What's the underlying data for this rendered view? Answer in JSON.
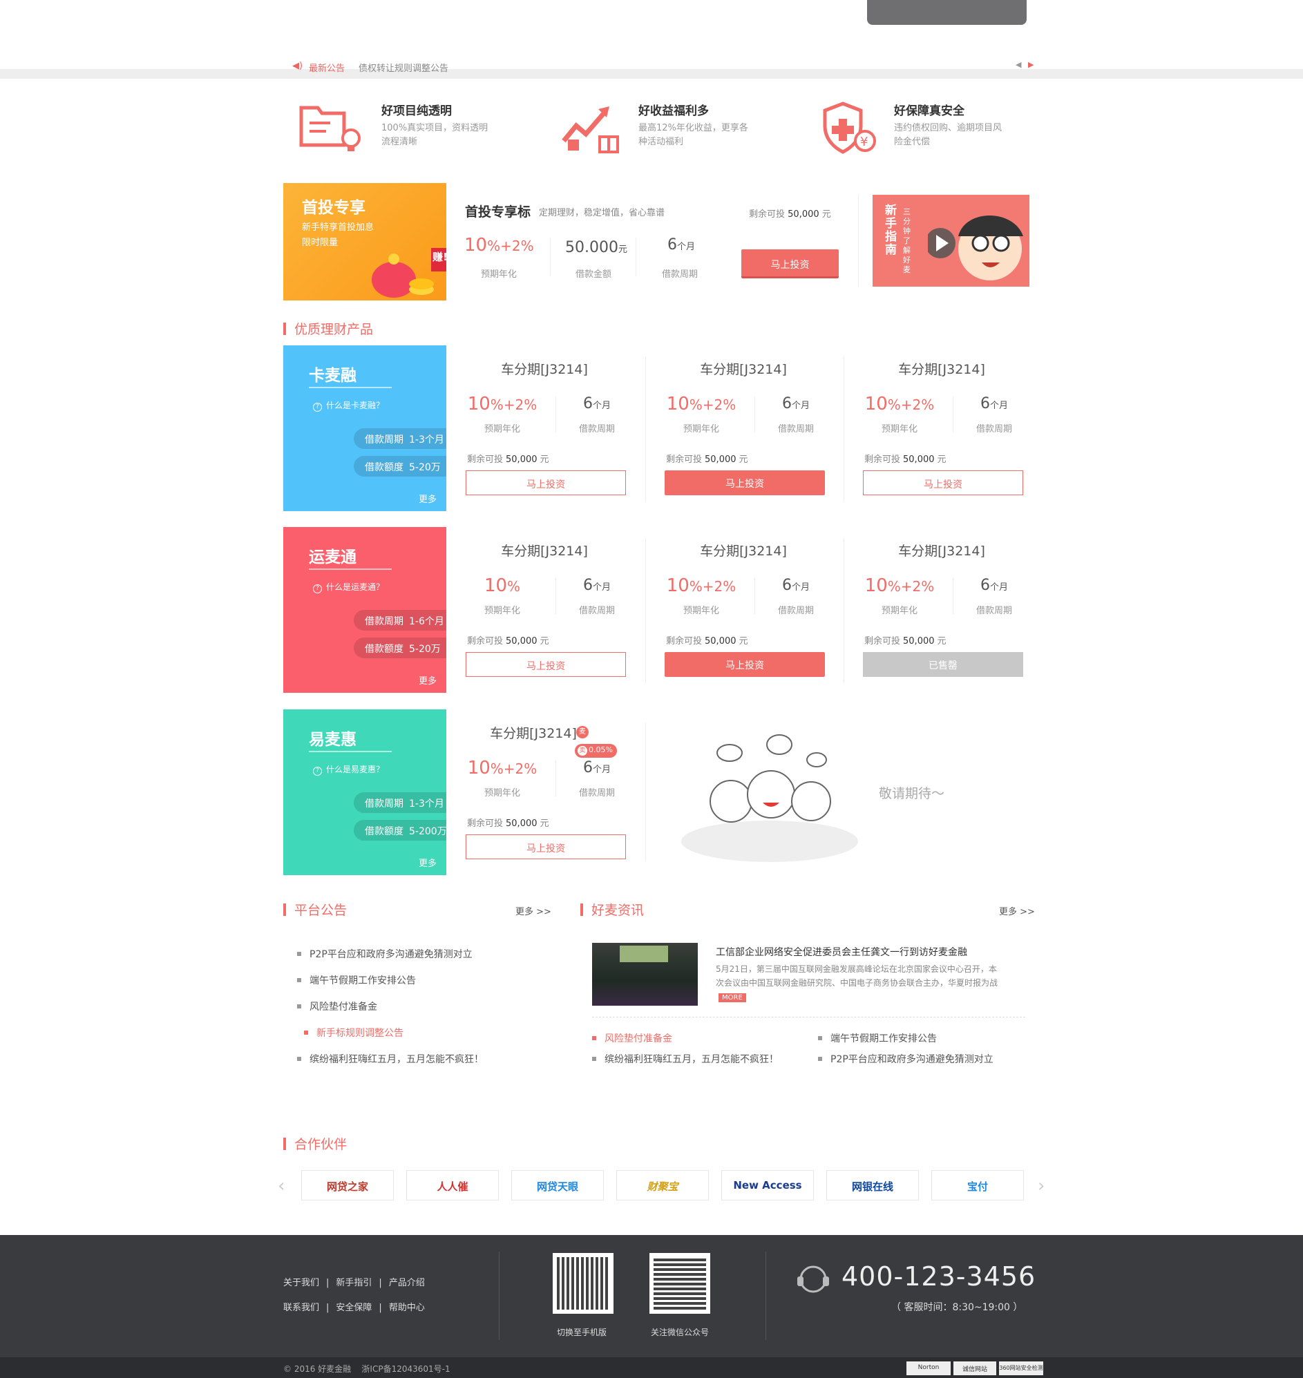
{
  "notice": {
    "icon": "speaker-icon",
    "title": "最新公告",
    "text": "债权转让规则调整公告"
  },
  "features": [
    {
      "icon": "folder-bulb-icon",
      "title": "好项目纯透明",
      "l1": "100%真实项目，资料透明",
      "l2": "流程清晰"
    },
    {
      "icon": "chart-gift-icon",
      "title": "好收益福利多",
      "l1": "最高12%年化收益，更享各",
      "l2": "种活动福利"
    },
    {
      "icon": "shield-yuan-icon",
      "title": "好保障真安全",
      "l1": "违约债权回购、逾期项目风",
      "l2": "险金代偿"
    }
  ],
  "first": {
    "banner_title": "首投专享",
    "banner_sub1": "新手特享首投加息",
    "banner_sub2": "限时限量",
    "banner_badge": "赚!",
    "name": "首投专享标",
    "tagline": "定期理财，稳定增值，省心靠谱",
    "remain_label": "剩余可投",
    "remain_value": "50,000",
    "remain_unit": "元",
    "rate": "10",
    "rate_plus": "%+2%",
    "rate_label": "预期年化",
    "amount": "50.000",
    "amount_unit": "元",
    "amount_label": "借款金额",
    "period": "6",
    "period_unit": "个月",
    "period_label": "借款周期",
    "button": "马上投资"
  },
  "guide": {
    "title": "新手指南",
    "sub": "三分钟了解好麦"
  },
  "products_section": "优质理财产品",
  "categories": [
    {
      "name": "卡麦融",
      "q": "什么是卡麦融？",
      "p1_label": "借款周期",
      "p1": "1-3个月",
      "p2_label": "借款额度",
      "p2": "5-20万",
      "more": "更多",
      "color": "#52c2fb"
    },
    {
      "name": "运麦通",
      "q": "什么是运麦通？",
      "p1_label": "借款周期",
      "p1": "1-6个月",
      "p2_label": "借款额度",
      "p2": "5-20万",
      "more": "更多",
      "color": "#fb5f6c"
    },
    {
      "name": "易麦惠",
      "q": "什么是易麦惠？",
      "p1_label": "借款周期",
      "p1": "1-3个月",
      "p2_label": "借款额度",
      "p2": "5-200万",
      "more": "更多",
      "color": "#3fd8b8"
    }
  ],
  "product_common": {
    "title": "车分期[J3214]",
    "rate_label": "预期年化",
    "period": "6",
    "period_unit": "个月",
    "period_label": "借款周期",
    "remain_label": "剩余可投",
    "remain_value": "50,000",
    "remain_unit": "元"
  },
  "rows": [
    [
      {
        "rate": "10",
        "plus": "%+2%",
        "btn": "马上投资",
        "style": "out"
      },
      {
        "rate": "10",
        "plus": "%+2%",
        "btn": "马上投资",
        "style": "red"
      },
      {
        "rate": "10",
        "plus": "%+2%",
        "btn": "马上投资",
        "style": "out"
      }
    ],
    [
      {
        "rate": "10",
        "plus": "%",
        "btn": "马上投资",
        "style": "out"
      },
      {
        "rate": "10",
        "plus": "%+2%",
        "btn": "马上投资",
        "style": "red"
      },
      {
        "rate": "10",
        "plus": "%+2%",
        "btn": "已售罄",
        "style": "gray"
      }
    ],
    [
      {
        "rate": "10",
        "plus": "%+2%",
        "btn": "马上投资",
        "style": "out",
        "badge1": "麦",
        "badge2": "0.05%",
        "badge2_icon": "卖"
      }
    ]
  ],
  "coming": "敬请期待～",
  "announce": {
    "title": "平台公告",
    "more": "更多 >>",
    "items": [
      "P2P平台应和政府多沟通避免猜测对立",
      "端午节假期工作安排公告",
      "风险垫付准备金",
      "新手标规则调整公告",
      "缤纷福利狂嗨红五月，五月怎能不疯狂！"
    ]
  },
  "news": {
    "title": "好麦资讯",
    "more": "更多 >>",
    "headline": "工信部企业网络安全促进委员会主任龚文一行到访好麦金融",
    "body1": "5月21日，第三届中国互联网金融发展高峰论坛在北京国家会议中心召开，本",
    "body2": "次会议由中国互联网金融研究院、中国电子商务协会联合主办，华夏时报为战",
    "more_tag": "MORE",
    "left": [
      "风险垫付准备金",
      "缤纷福利狂嗨红五月，五月怎能不疯狂！"
    ],
    "right": [
      "端午节假期工作安排公告",
      "P2P平台应和政府多沟通避免猜测对立"
    ]
  },
  "partners_title": "合作伙伴",
  "partners": [
    "网贷之家",
    "人人催",
    "网贷天眼",
    "财聚宝",
    "New Access",
    "网银在线",
    "宝付"
  ],
  "footer": {
    "links1": [
      "关于我们",
      "新手指引",
      "产品介绍"
    ],
    "links2": [
      "联系我们",
      "安全保障",
      "帮助中心"
    ],
    "qr1": "切换至手机版",
    "qr2": "关注微信公众号",
    "phone": "400-123-3456",
    "hours": "（ 客服时间：8:30~19:00 ）",
    "copyright": "© 2016 好麦金融    浙ICP备12043601号-1",
    "badges": [
      "Norton",
      "诚信网站",
      "360网站安全检测"
    ]
  },
  "colors": {
    "accent": "#f26c67",
    "orange": "#fb9a1a",
    "blue": "#52c2fb",
    "red": "#fb5f6c",
    "teal": "#3fd8b8",
    "footer": "#3a3b3f"
  }
}
